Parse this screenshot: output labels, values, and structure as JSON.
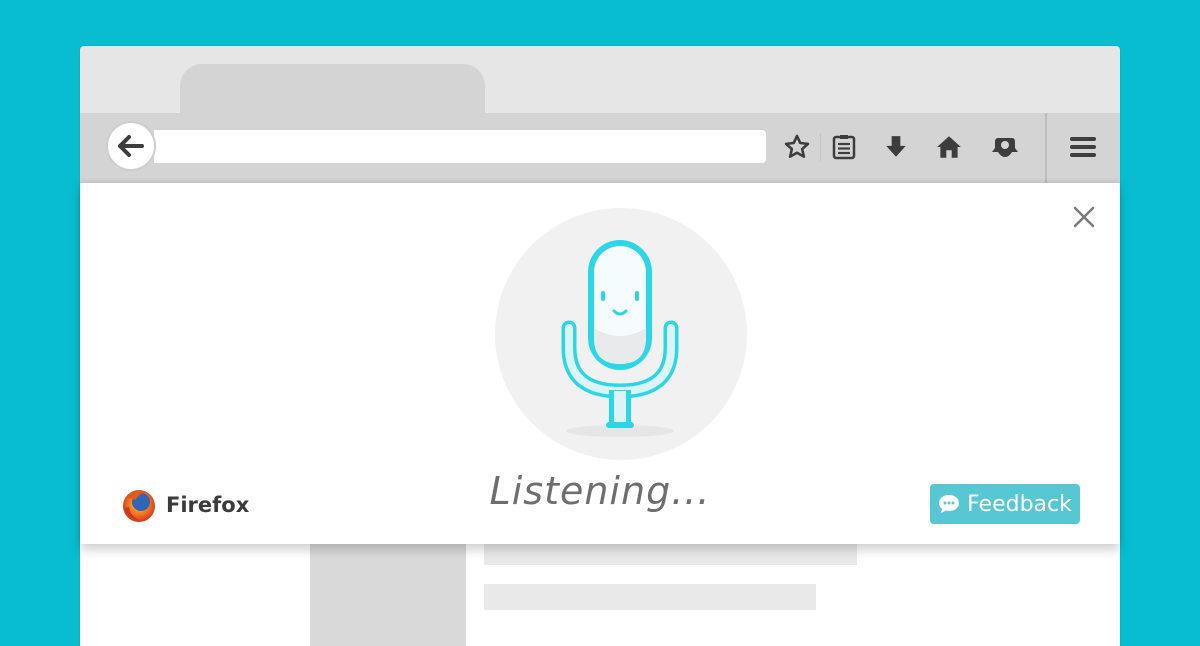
{
  "browser": {
    "toolbar": {
      "icons": [
        "back-arrow-icon",
        "star-icon",
        "reading-list-icon",
        "download-icon",
        "home-icon",
        "pocket-icon",
        "hamburger-menu-icon"
      ]
    }
  },
  "voice_panel": {
    "status": "Listening...",
    "brand_name": "Firefox",
    "feedback_label": "Feedback",
    "close_icon": "close-icon"
  },
  "colors": {
    "background": "#07bdcf",
    "accent": "#2bd7e6",
    "feedback_button": "#58c7d4"
  }
}
